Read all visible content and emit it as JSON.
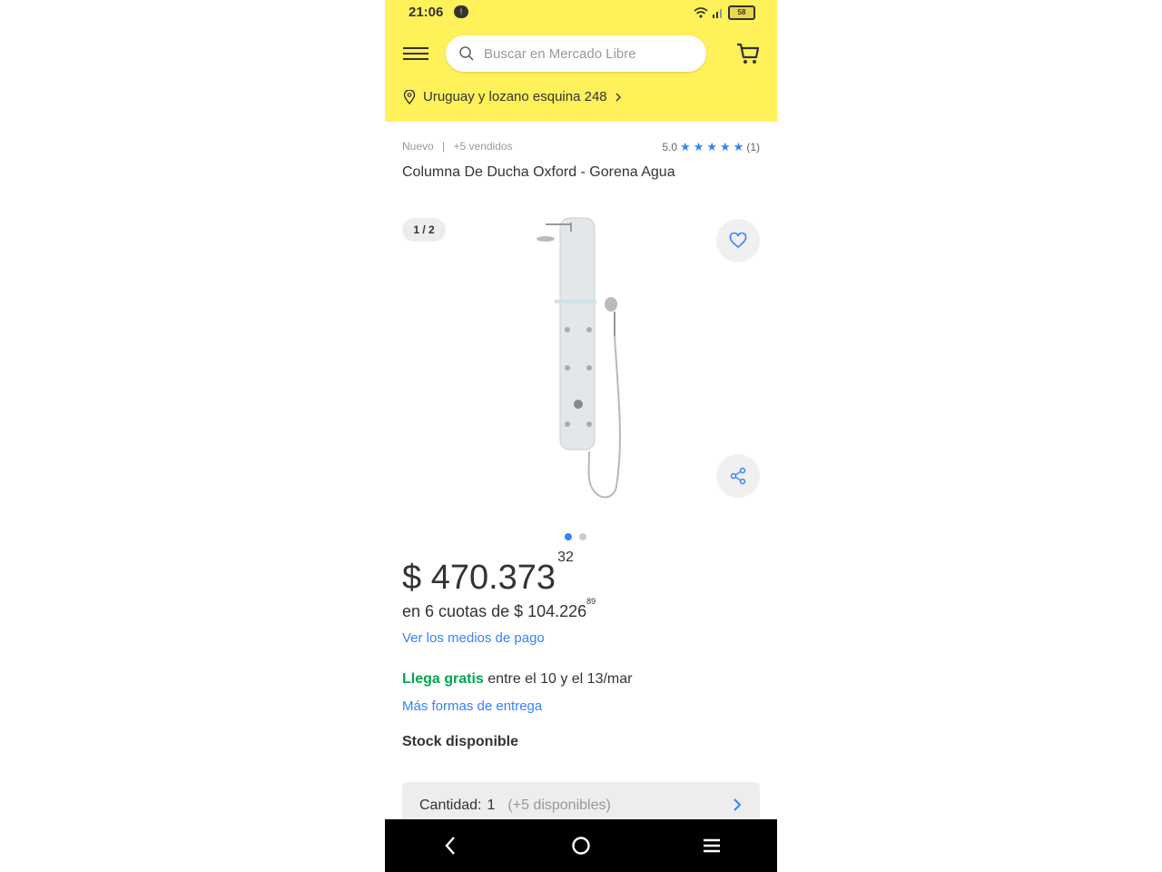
{
  "status_bar": {
    "time": "21:06",
    "notification_count": "!",
    "battery": "58"
  },
  "header": {
    "search_placeholder": "Buscar en Mercado Libre",
    "location": "Uruguay y lozano esquina 248"
  },
  "product": {
    "condition": "Nuevo",
    "separator": "|",
    "sold": "+5 vendidos",
    "rating": "5.0",
    "rating_stars": 5,
    "reviews": "(1)",
    "title": "Columna De Ducha Oxford - Gorena Agua",
    "image_counter": "1 / 2",
    "price_main": "$ 470.373",
    "price_cents": "32",
    "installments_text": "en 6 cuotas de $ 104.226",
    "installments_cents": "89",
    "payment_link": "Ver los medios de pago",
    "delivery_highlight": "Llega gratis",
    "delivery_text": "entre el 10 y el 13/mar",
    "delivery_link": "Más formas de entrega",
    "stock": "Stock disponible",
    "quantity_label": "Cantidad:",
    "quantity_value": "1",
    "quantity_available": "(+5 disponibles)"
  },
  "colors": {
    "brand_yellow": "#fff159",
    "link_blue": "#3483fa",
    "free_green": "#00a650"
  },
  "icons": [
    "menu-icon",
    "search-icon",
    "cart-icon",
    "location-pin-icon",
    "chevron-right-icon",
    "heart-icon",
    "share-icon",
    "back-icon",
    "home-icon",
    "recents-icon"
  ]
}
